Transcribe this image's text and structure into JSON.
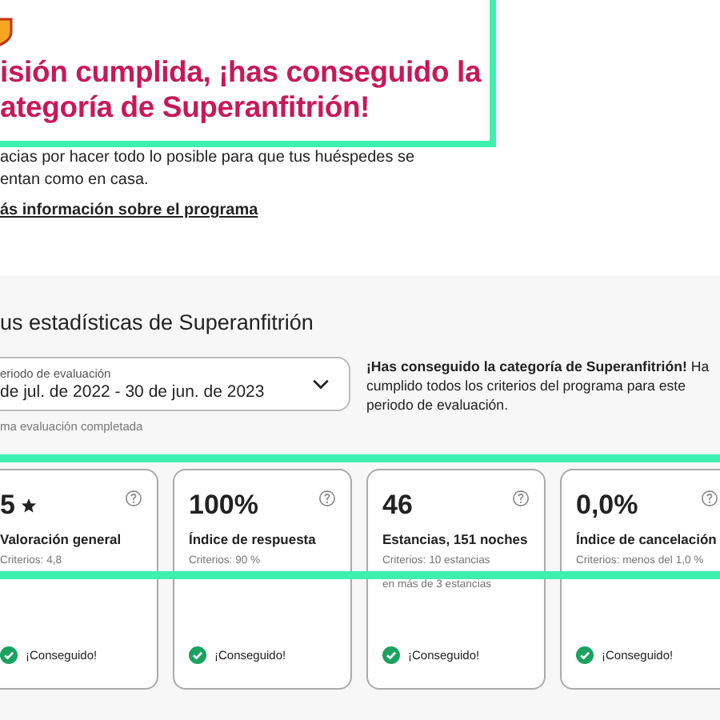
{
  "header": {
    "title_lines": [
      "isión cumplida, ¡has conseguido la",
      "ategoría de Superanfitrión!"
    ],
    "description_lines": [
      "acias por hacer todo lo posible para que tus huéspedes se",
      "entan como en casa."
    ],
    "link": "ás información sobre el programa"
  },
  "stats": {
    "title": "us estadísticas de Superanfitrión",
    "period": {
      "label": "eriodo de evaluación",
      "value": "de jul. de 2022 - 30 de jun. de 2023",
      "helper": "ma evaluación completada"
    },
    "message_lines": [
      "**¡Has conseguido la categoría de Superanfitrión!** Ha",
      "cumplido todos los criterios del programa para este",
      "periodo de evaluación."
    ],
    "cards": [
      {
        "value": "5",
        "star": true,
        "label": "Valoración general",
        "criteria": [
          "Criterios: 4,8"
        ],
        "status": "¡Conseguido!",
        "achieved": true
      },
      {
        "value": "100%",
        "star": false,
        "label": "Índice de respuesta",
        "criteria": [
          "Criterios: 90 %"
        ],
        "status": "¡Conseguido!",
        "achieved": true
      },
      {
        "value": "46",
        "star": false,
        "label": "Estancias, 151 noches",
        "criteria": [
          "Criterios: 10 estancias",
          "en más de 3 estancias"
        ],
        "status": "¡Conseguido!",
        "achieved": true
      },
      {
        "value": "0,0%",
        "star": false,
        "label": "Índice de cancelación",
        "criteria": [
          "Criterios: menos del 1,0 %"
        ],
        "status": "¡Conseguido!",
        "achieved": true
      }
    ]
  }
}
